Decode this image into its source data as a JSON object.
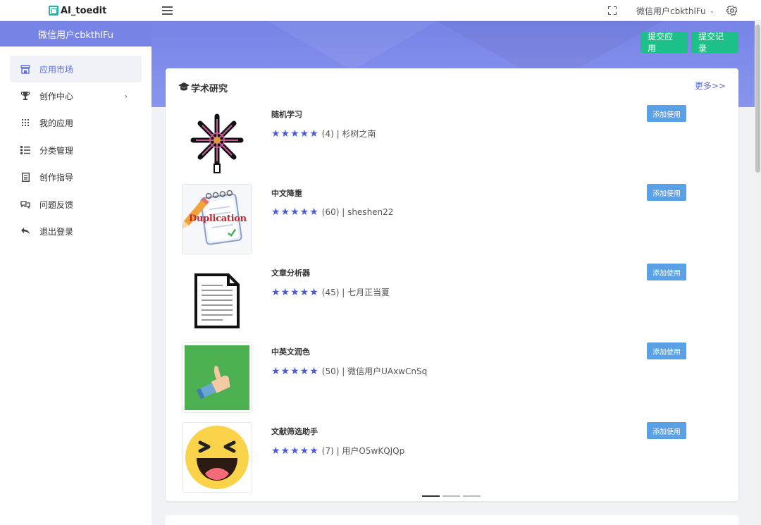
{
  "header": {
    "logo_text": "AI_toedit",
    "user_name": "微信用户cbkthlFu"
  },
  "banner": {
    "user_name": "微信用户cbkthlFu",
    "submit_app_label": "提交应用",
    "submit_records_label": "提交记录"
  },
  "sidebar": {
    "items": [
      {
        "label": "应用市场",
        "icon": "store-icon",
        "active": true
      },
      {
        "label": "创作中心",
        "icon": "trophy-icon",
        "has_children": true
      },
      {
        "label": "我的应用",
        "icon": "grid-icon"
      },
      {
        "label": "分类管理",
        "icon": "list-icon"
      },
      {
        "label": "创作指导",
        "icon": "document-icon"
      },
      {
        "label": "问题反馈",
        "icon": "feedback-icon"
      },
      {
        "label": "退出登录",
        "icon": "logout-icon"
      }
    ]
  },
  "section": {
    "title": "学术研究",
    "more_label": "更多>>",
    "add_label": "添加使用",
    "apps": [
      {
        "name": "随机学习",
        "rating_text": "(4) | 杉树之南",
        "stars": 5
      },
      {
        "name": "中文降重",
        "rating_text": "(60) | sheshen22",
        "stars": 5,
        "thumb_text": "Duplication"
      },
      {
        "name": "文章分析器",
        "rating_text": "(45) | 七月正当夏",
        "stars": 5
      },
      {
        "name": "中英文润色",
        "rating_text": "(50) | 微信用户UAxwCnSq",
        "stars": 5
      },
      {
        "name": "文献筛选助手",
        "rating_text": "(7) | 用户O5wKQJQp",
        "stars": 5
      }
    ]
  },
  "colors": {
    "accent": "#5b6ce1",
    "banner": "#7784e6",
    "green_button": "#1ec08a",
    "add_button": "#5aa0e6",
    "star": "#4a5bd8"
  }
}
